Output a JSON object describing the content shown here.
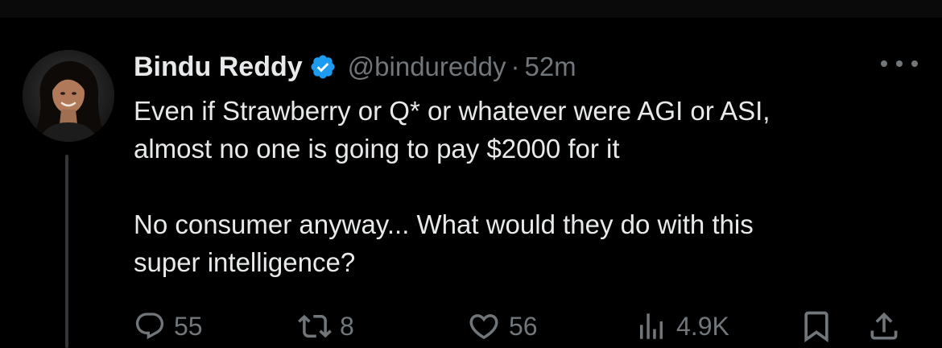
{
  "tweet": {
    "author": {
      "name": "Bindu Reddy",
      "handle": "@bindureddy",
      "verified": true
    },
    "separator": "·",
    "time": "52m",
    "text": {
      "line1": "Even if Strawberry or Q* or whatever were AGI or ASI,",
      "line2": "almost no one is going to pay $2000 for it",
      "line3": "No consumer anyway... What would they do with this",
      "line4": "super intelligence?"
    },
    "stats": {
      "replies": "55",
      "reposts": "8",
      "likes": "56",
      "views": "4.9K"
    }
  },
  "colors": {
    "background": "#000000",
    "text": "#e7e9ea",
    "muted": "#71767b",
    "verified": "#1d9bf0",
    "thread_line": "#333639"
  },
  "icons": {
    "verified": "verified-badge-icon",
    "more": "more-options-icon",
    "reply": "reply-icon",
    "repost": "repost-icon",
    "like": "heart-icon",
    "views": "views-chart-icon",
    "bookmark": "bookmark-icon",
    "share": "share-icon"
  }
}
